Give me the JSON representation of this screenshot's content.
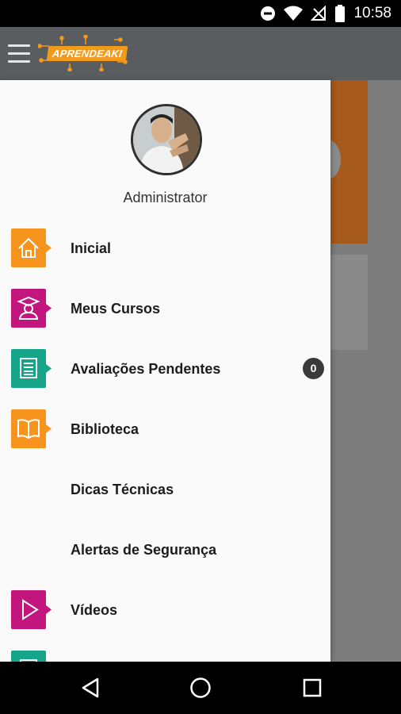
{
  "status_bar": {
    "time": "10:58"
  },
  "app_bar": {
    "logo_text": "APRENDEAKI",
    "brand_color": "#f29a1d"
  },
  "drawer": {
    "user_name": "Administrator",
    "items": [
      {
        "label": "Inicial",
        "icon": "home-icon",
        "color": "#f7941d"
      },
      {
        "label": "Meus Cursos",
        "icon": "graduate-icon",
        "color": "#c2157e"
      },
      {
        "label": "Avaliações Pendentes",
        "icon": "checklist-icon",
        "color": "#17a589",
        "badge": "0"
      },
      {
        "label": "Biblioteca",
        "icon": "book-icon",
        "color": "#f7941d"
      },
      {
        "label": "Dicas Técnicas"
      },
      {
        "label": "Alertas de Segurança"
      },
      {
        "label": "Vídeos",
        "icon": "play-icon",
        "color": "#c2157e"
      },
      {
        "label": "",
        "icon": "checklist-icon",
        "color": "#17a589"
      }
    ]
  }
}
